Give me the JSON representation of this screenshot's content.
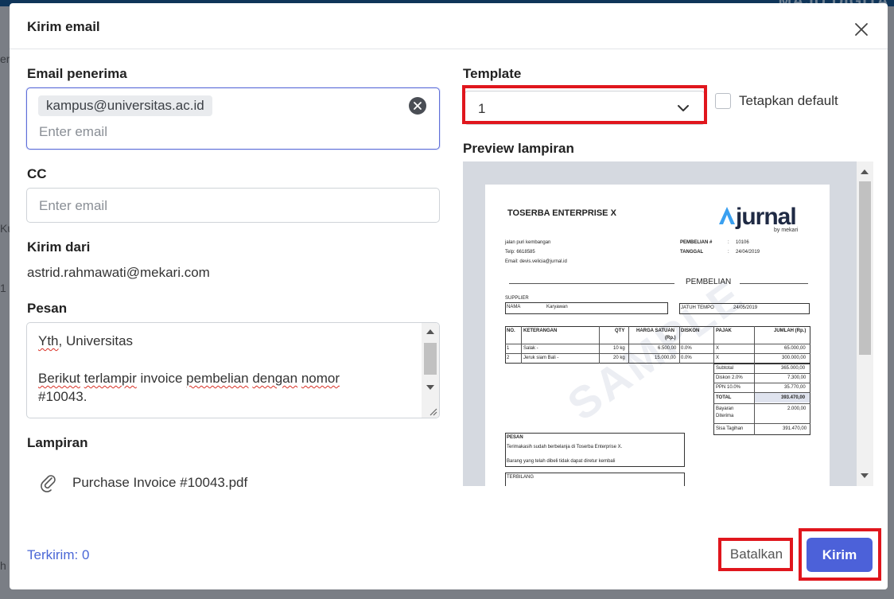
{
  "background": {
    "brand_text": "MAJU DIGITA",
    "edge_texts": [
      "er",
      "Ku",
      "1 d",
      "h"
    ]
  },
  "modal": {
    "title": "Kirim email"
  },
  "recipient": {
    "label": "Email penerima",
    "chip": "kampus@universitas.ac.id",
    "placeholder": "Enter email"
  },
  "cc": {
    "label": "CC",
    "placeholder": "Enter email"
  },
  "sender": {
    "label": "Kirim dari",
    "value": "astrid.rahmawati@mekari.com"
  },
  "message": {
    "label": "Pesan",
    "line1a": "Yth",
    "line1b": ", Universitas",
    "line2a": "Berikut",
    "line2b": " ",
    "line2c": "terlampir",
    "line2d": " invoice ",
    "line2e": "pembelian",
    "line2f": " ",
    "line2g": "dengan",
    "line2h": " ",
    "line2i": "nomor",
    "line3": "#10043."
  },
  "attachment": {
    "label": "Lampiran",
    "file": "Purchase Invoice #10043.pdf"
  },
  "template": {
    "label": "Template",
    "value": "1",
    "default_label": "Tetapkan default"
  },
  "preview": {
    "label": "Preview lampiran",
    "doc": {
      "company": "TOSERBA ENTERPRISE X",
      "logo": "jurnal",
      "logo_sub": "by mekari",
      "address": "jalan puri kembangan",
      "phone": "Telp: 6618585",
      "email": "Email: devis.velicia@jurnal.id",
      "purchase_no_label": "PEMBELIAN #",
      "purchase_no": "10106",
      "date_label": "TANGGAL",
      "date": "24/04/2019",
      "section_title": "PEMBELIAN",
      "supplier_label": "SUPPLIER",
      "name_label": "NAMA",
      "name_value": "Karyawan",
      "due_label": "JATUH TEMPO",
      "due_value": "24/05/2019",
      "colon": ":",
      "headers": {
        "no": "NO.",
        "desc": "KETERANGAN",
        "qty": "QTY",
        "price": "HARGA SATUAN",
        "price2": "(Rp.)",
        "disc": "DISKON",
        "tax": "PAJAK",
        "amount": "JUMLAH (Rp.)"
      },
      "rows": [
        {
          "no": "1",
          "desc": "Salak -",
          "qty": "10 kg",
          "price": "6.500,00",
          "disc": "0.0%",
          "tax": "X",
          "amount": "65.000,00"
        },
        {
          "no": "2",
          "desc": "Jeruk siam Bali -",
          "qty": "20 kg",
          "price": "15.000,00",
          "disc": "0.0%",
          "tax": "X",
          "amount": "300.000,00"
        }
      ],
      "summary": [
        {
          "label": "Subtotal",
          "value": "365.000,00"
        },
        {
          "label": "Diskon 2.0%",
          "value": "7.300,00"
        },
        {
          "label": "PPN 10.0%",
          "value": "35.770,00"
        },
        {
          "label": "TOTAL",
          "value": "393.470,00"
        },
        {
          "label": "Bayaran",
          "label2": "Diterima",
          "value": "2.000,00"
        },
        {
          "label": "Sisa Tagihan",
          "value": "391.470,00"
        }
      ],
      "note_label": "PESAN",
      "note1": "Terimakasih sudah berbelanja di Toserba Enterprise X.",
      "note2": "Barang yang telah dibeli tidak dapat diretur kembali",
      "terbilang": "TERBILANG",
      "watermark": "SAMPLE"
    }
  },
  "footer": {
    "sent_count": "Terkirim: 0",
    "cancel": "Batalkan",
    "send": "Kirim"
  },
  "colors": {
    "primary": "#4c61d9",
    "highlight": "#e0161d",
    "link": "#4a67d6"
  }
}
